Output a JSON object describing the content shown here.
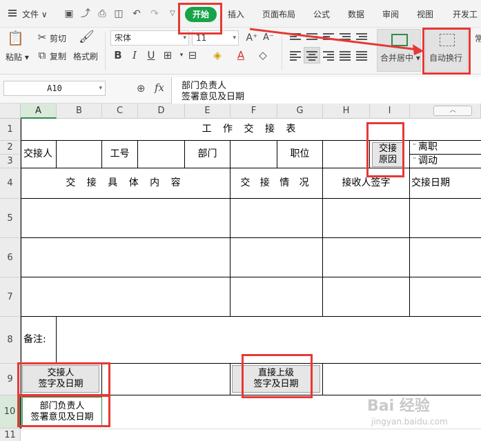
{
  "menubar": {
    "file_label": "文件",
    "tabs": [
      "开始",
      "插入",
      "页面布局",
      "公式",
      "数据",
      "审阅",
      "视图",
      "开发工"
    ],
    "active_tab": "开始"
  },
  "ribbon": {
    "paste_label": "粘贴",
    "cut_label": "剪切",
    "copy_label": "复制",
    "format_painter_label": "格式刷",
    "font_name": "宋体",
    "font_size": "11",
    "merge_center_label": "合并居中",
    "wrap_text_label": "自动换行",
    "edge_label": "常"
  },
  "formula_bar": {
    "name_box": "A10",
    "fx_label": "fx",
    "formula_line1": "部门负责人",
    "formula_line2": "签署意见及日期"
  },
  "sheet": {
    "columns": [
      "A",
      "B",
      "C",
      "D",
      "E",
      "F",
      "G",
      "H",
      "I"
    ],
    "selected_column": "A",
    "rows": [
      "1",
      "2",
      "3",
      "4",
      "5",
      "6",
      "7",
      "8",
      "9",
      "10",
      "11"
    ],
    "selected_row": "10",
    "title": "工 作 交 接 表",
    "handover_person": "交接人",
    "employee_no": "工号",
    "department": "部门",
    "position": "职位",
    "reason_line1": "交接",
    "reason_line2": "原因",
    "reason_opt1": "离职",
    "reason_opt2": "调动",
    "opt_mark": "¨",
    "content_header": "交 接 具 体 内 容",
    "status_header": "交 接 情 况",
    "receiver_sign": "接收人签字",
    "handover_date": "交接日期",
    "remarks": "备注:",
    "handover_sign_line1": "交接人",
    "handover_sign_line2": "签字及日期",
    "superior_line1": "直接上级",
    "superior_line2": "签字及日期",
    "dept_head_line1": "部门负责人",
    "dept_head_line2": "签署意见及日期"
  },
  "watermark": {
    "brand": "Bai 经验",
    "url": "jingyan.baidu.com"
  },
  "colors": {
    "accent_green": "#16a34a",
    "callout_red": "#e53935"
  }
}
